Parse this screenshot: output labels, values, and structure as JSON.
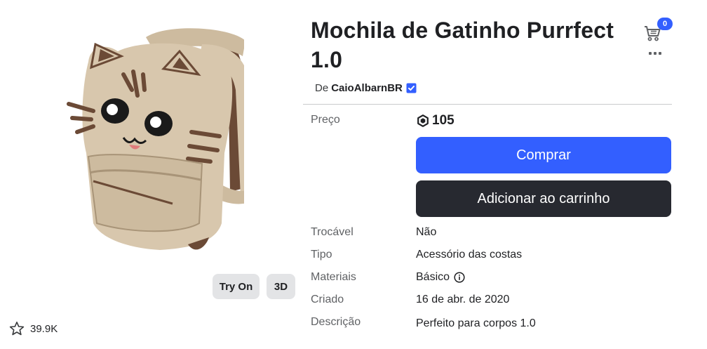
{
  "item": {
    "title": "Mochila de Gatinho Purrfect 1.0",
    "creator_prefix": "De",
    "creator_name": "CaioAlbarnBR",
    "favorites": "39.9K"
  },
  "media": {
    "try_on_label": "Try On",
    "three_d_label": "3D"
  },
  "header": {
    "cart_count": "0"
  },
  "price": {
    "label": "Preço",
    "value": "105",
    "currency_icon": "robux-icon"
  },
  "actions": {
    "buy_label": "Comprar",
    "add_to_cart_label": "Adicionar ao carrinho"
  },
  "details": {
    "tradable_label": "Trocável",
    "tradable_value": "Não",
    "type_label": "Tipo",
    "type_value": "Acessório das costas",
    "materials_label": "Materiais",
    "materials_value": "Básico",
    "created_label": "Criado",
    "created_value": "16 de abr. de 2020",
    "description_label": "Descrição",
    "description_value": "Perfeito para corpos 1.0"
  },
  "colors": {
    "primary": "#335fff",
    "dark_button": "#272930",
    "backpack": "#d8c7ad",
    "strap": "#6b4a36"
  }
}
